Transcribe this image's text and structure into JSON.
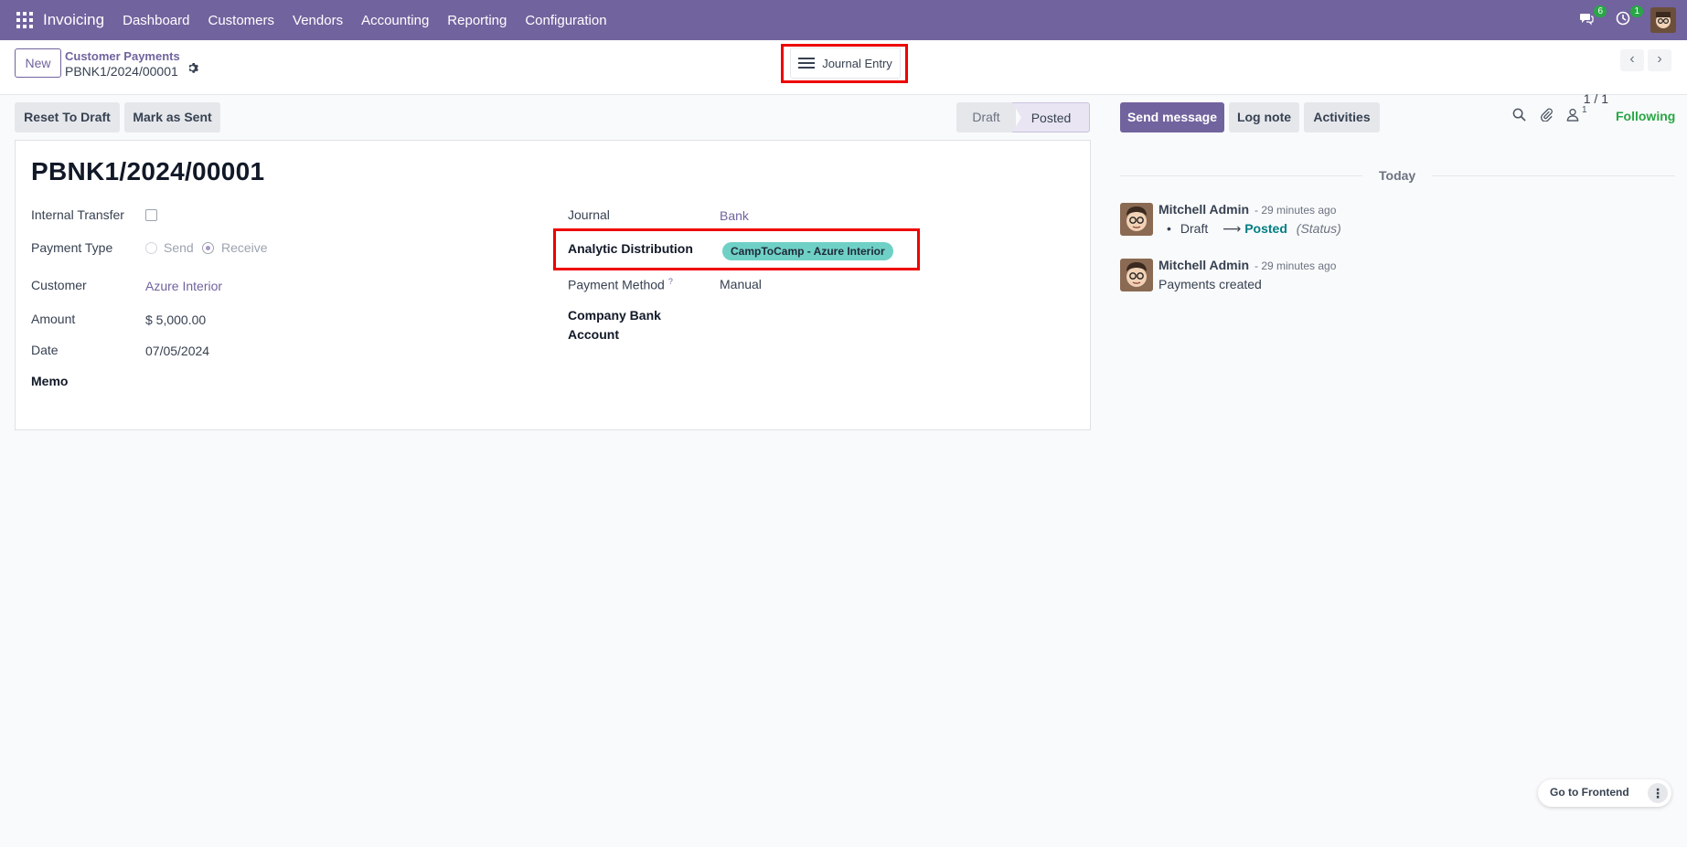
{
  "navbar": {
    "brand": "Invoicing",
    "menu": [
      "Dashboard",
      "Customers",
      "Vendors",
      "Accounting",
      "Reporting",
      "Configuration"
    ],
    "messages_count": "6",
    "activities_count": "1"
  },
  "control": {
    "new_label": "New",
    "breadcrumb_parent": "Customer Payments",
    "breadcrumb_current": "PBNK1/2024/00001",
    "journal_entry_label": "Journal Entry",
    "pager": "1 / 1"
  },
  "actions": {
    "reset_to_draft": "Reset To Draft",
    "mark_as_sent": "Mark as Sent",
    "status_draft": "Draft",
    "status_posted": "Posted"
  },
  "form": {
    "title": "PBNK1/2024/00001",
    "internal_transfer_label": "Internal Transfer",
    "payment_type_label": "Payment Type",
    "payment_type_send": "Send",
    "payment_type_receive": "Receive",
    "customer_label": "Customer",
    "customer_value": "Azure Interior",
    "amount_label": "Amount",
    "amount_value": "$ 5,000.00",
    "date_label": "Date",
    "date_value": "07/05/2024",
    "memo_label": "Memo",
    "journal_label": "Journal",
    "journal_value": "Bank",
    "analytic_label": "Analytic Distribution",
    "analytic_tag": "CampToCamp - Azure Interior",
    "payment_method_label": "Payment Method",
    "payment_method_help": "?",
    "payment_method_value": "Manual",
    "company_bank_label_1": "Company Bank",
    "company_bank_label_2": "Account"
  },
  "chatter": {
    "send_message": "Send message",
    "log_note": "Log note",
    "activities": "Activities",
    "followers_count": "1",
    "following": "Following",
    "today": "Today",
    "messages": [
      {
        "author": "Mitchell Admin",
        "time": "- 29 minutes ago",
        "from": "Draft",
        "to": "Posted",
        "field": "(Status)"
      },
      {
        "author": "Mitchell Admin",
        "time": "- 29 minutes ago",
        "body": "Payments created"
      }
    ]
  },
  "frontend": {
    "label": "Go to Frontend"
  },
  "colors": {
    "brand": "#71639e",
    "following": "#28a745",
    "tag": "#6fd0c6",
    "highlight": "#e00000"
  }
}
